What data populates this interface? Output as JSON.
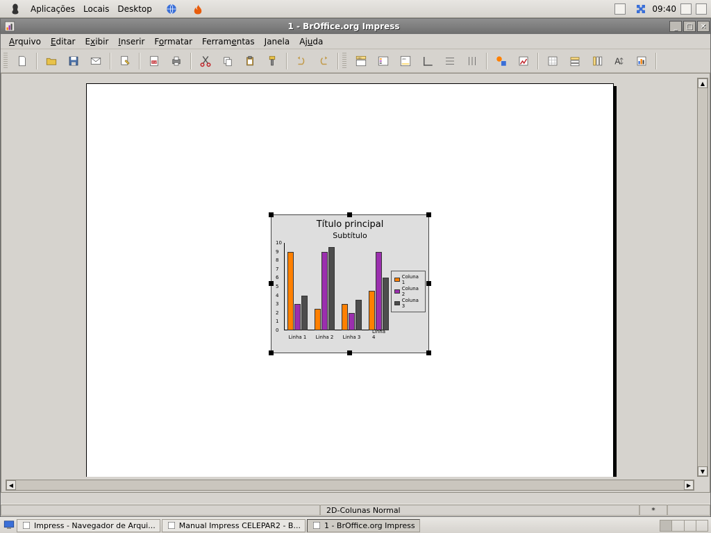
{
  "gnome_panel": {
    "menu": [
      "Aplicações",
      "Locais",
      "Desktop"
    ],
    "clock": "09:40"
  },
  "window": {
    "title": "1 - BrOffice.org Impress",
    "menus": [
      {
        "label": "Arquivo",
        "u": 0
      },
      {
        "label": "Editar",
        "u": 0
      },
      {
        "label": "Exibir",
        "u": 1
      },
      {
        "label": "Inserir",
        "u": 0
      },
      {
        "label": "Formatar",
        "u": 1
      },
      {
        "label": "Ferramentas",
        "u": 6
      },
      {
        "label": "Janela",
        "u": 0
      },
      {
        "label": "Ajuda",
        "u": 2
      }
    ],
    "status": {
      "type": "2D-Colunas Normal",
      "mark": "*"
    }
  },
  "taskbar": {
    "items": [
      {
        "label": "Impress - Navegador de Arqui...",
        "active": false
      },
      {
        "label": "Manual Impress CELEPAR2 - B...",
        "active": false
      },
      {
        "label": "1 - BrOffice.org Impress",
        "active": true
      }
    ]
  },
  "chart_data": {
    "type": "bar",
    "title": "Título principal",
    "subtitle": "Subtítulo",
    "categories": [
      "Linha 1",
      "Linha 2",
      "Linha 3",
      "Linha 4"
    ],
    "series": [
      {
        "name": "Coluna 1",
        "color": "#ff8000",
        "values": [
          9,
          2.5,
          3,
          4.5
        ]
      },
      {
        "name": "Coluna 2",
        "color": "#9b2fae",
        "values": [
          3,
          9,
          2,
          9
        ]
      },
      {
        "name": "Coluna 3",
        "color": "#4d4d4d",
        "values": [
          4,
          9.5,
          3.5,
          6
        ]
      }
    ],
    "ylim": [
      0,
      10
    ],
    "yticks": [
      0,
      1,
      2,
      3,
      4,
      5,
      6,
      7,
      8,
      9,
      10
    ]
  }
}
